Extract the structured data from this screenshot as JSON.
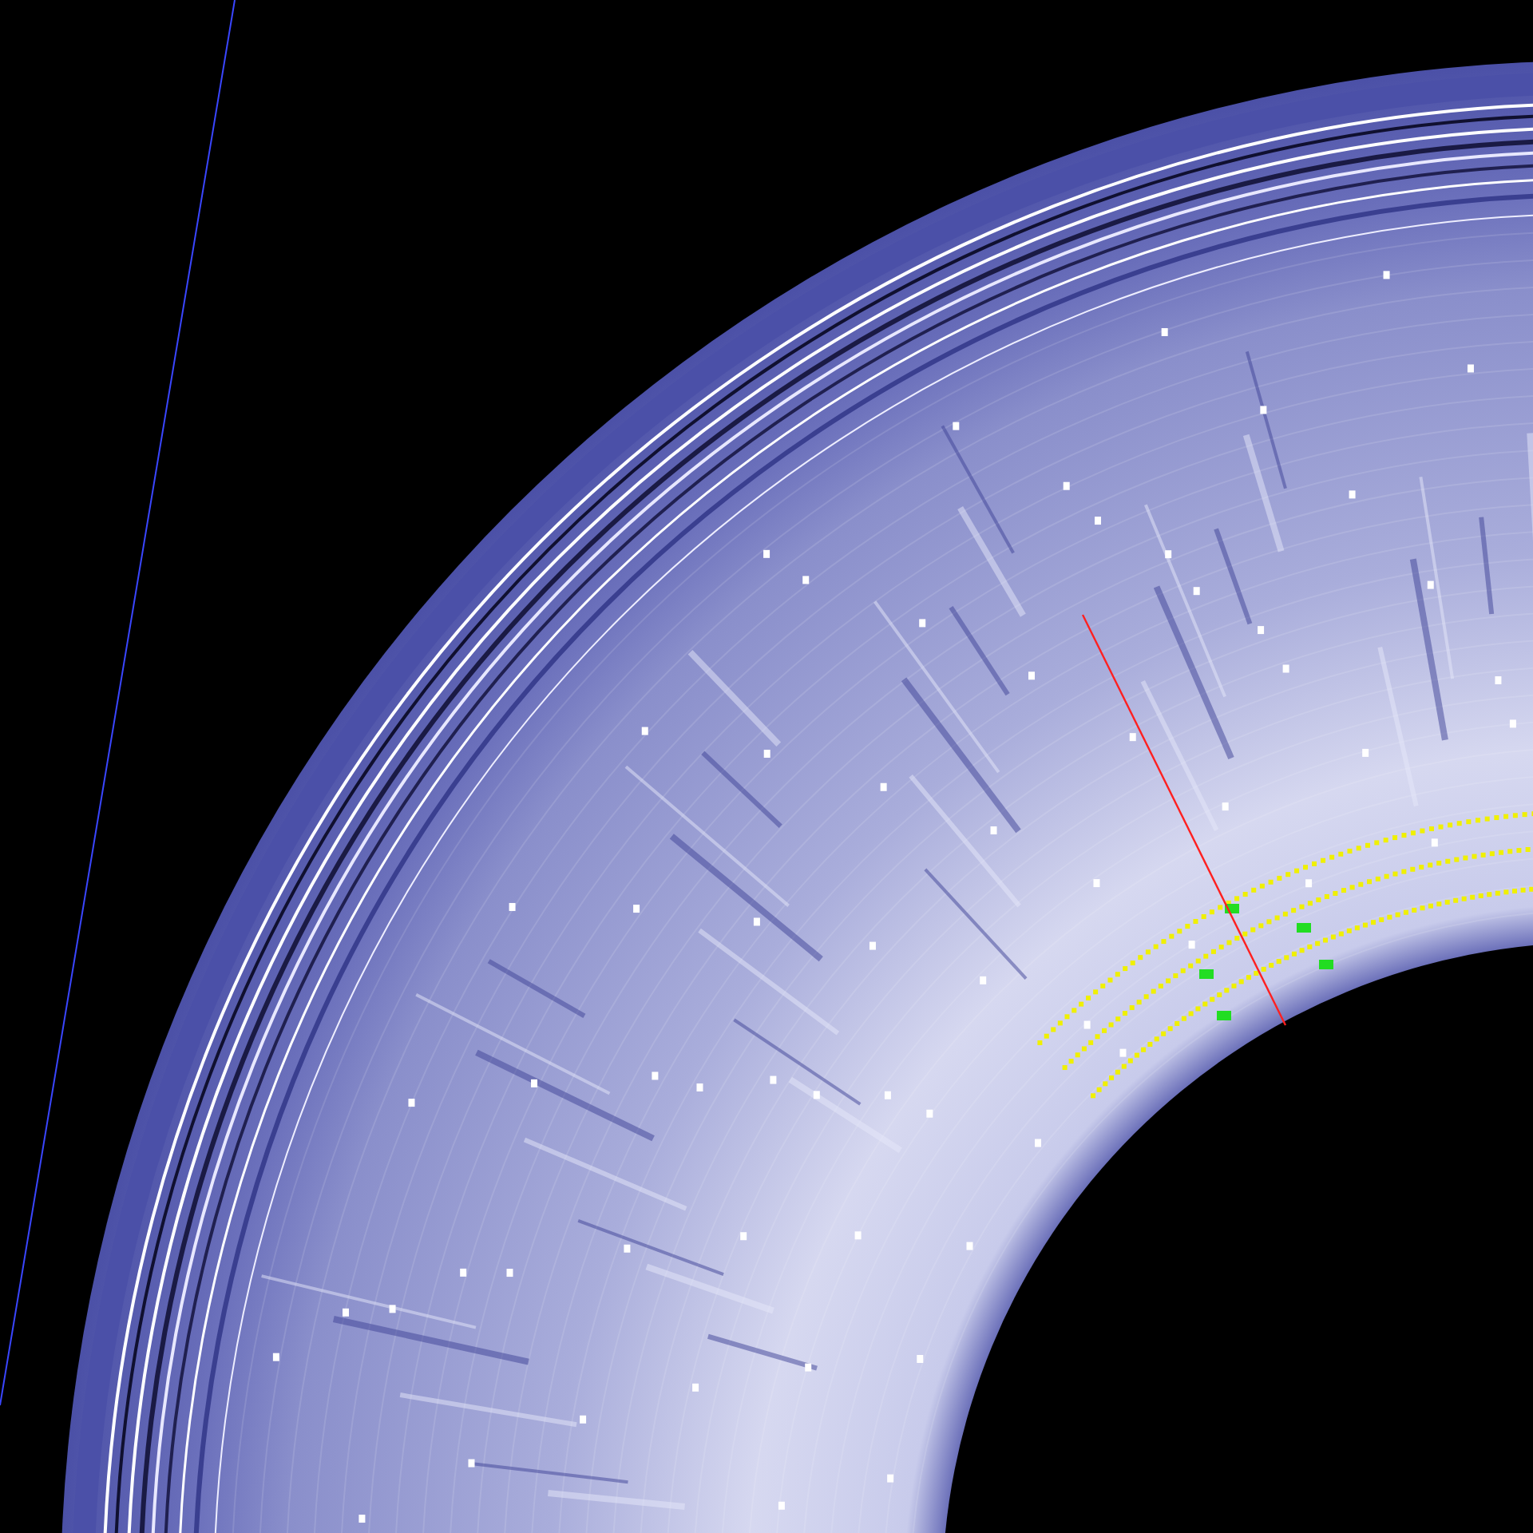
{
  "image": {
    "kind": "diffraction-pattern"
  }
}
